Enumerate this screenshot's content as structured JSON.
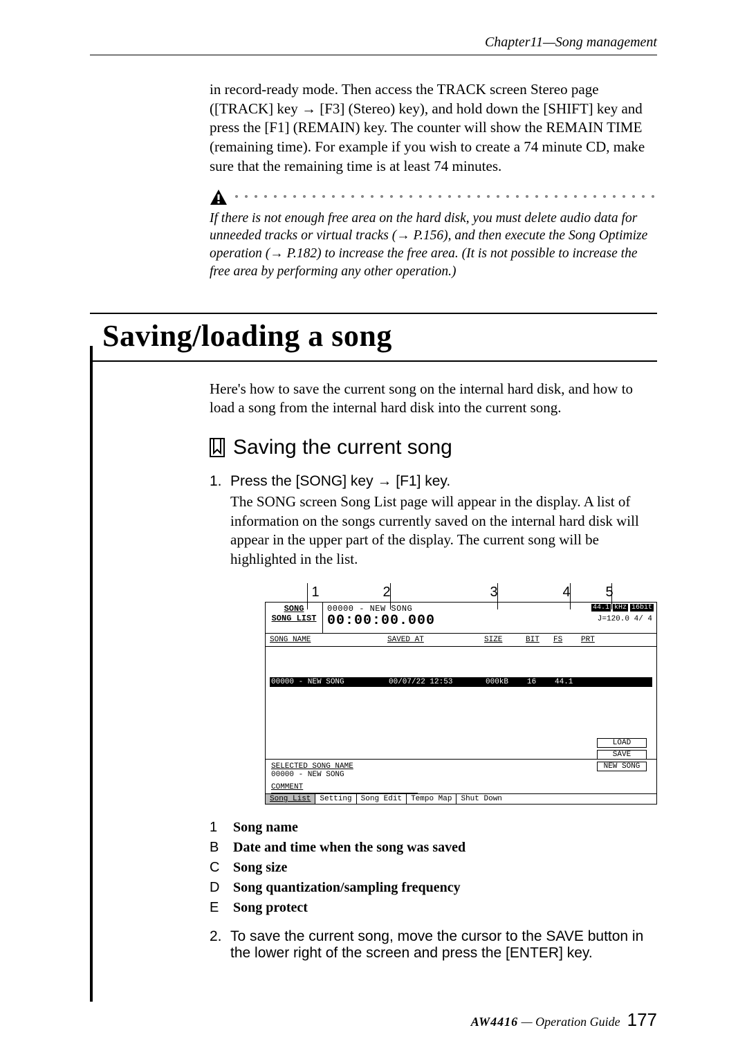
{
  "header": {
    "chapter": "Chapter11—Song management"
  },
  "intro_continued": "in record-ready mode. Then access the TRACK screen Stereo page ([TRACK] key → [F3] (Stereo) key), and hold down the [SHIFT] key and press the [F1] (REMAIN) key. The counter will show the REMAIN TIME (remaining time). For example if you wish to create a 74 minute CD, make sure that the remaining time is at least 74 minutes.",
  "warning": "If there is not enough free area on the hard disk, you must delete audio data for unneeded tracks or virtual tracks (→ P.156), and then execute the Song Optimize operation (→ P.182) to increase the free area. (It is not possible to increase the free area by performing any other operation.)",
  "h1": "Saving/loading a song",
  "intro2": "Here's how to save the current song on the internal hard disk, and how to load a song from the internal hard disk into the current song.",
  "subhead": "Saving the current song",
  "step1": {
    "num": "1.",
    "cmd": "Press the [SONG] key → [F1] key.",
    "detail": "The SONG screen Song List page will appear in the display. A list of information on the songs currently saved on the internal hard disk will appear in the upper part of the display. The current song will be highlighted in the list."
  },
  "callouts": [
    "1",
    "2",
    "3",
    "4",
    "5"
  ],
  "lcd": {
    "title1": "SONG",
    "title2": "SONG LIST",
    "status1": "00000 - NEW SONG",
    "time": "00:00:00.000",
    "chips": {
      "a": "44.1",
      "b": "kHz",
      "c": "16bit"
    },
    "below": "J=120.0   4/ 4",
    "cols": {
      "name": "SONG NAME",
      "saved": "SAVED AT",
      "size": "SIZE",
      "bit": "BIT",
      "fs": "FS",
      "prt": "PRT"
    },
    "row": {
      "name": "00000 - NEW SONG",
      "saved": "00/07/22 12:53",
      "size": "000kB",
      "bit": "16",
      "fs": "44.1"
    },
    "selected_label": "SELECTED SONG NAME",
    "selected_value": "00000 - NEW SONG",
    "comment_label": "COMMENT",
    "buttons": {
      "load": "LOAD",
      "save": "SAVE",
      "new": "NEW SONG"
    },
    "tabs": {
      "a": "Song List",
      "b": "Setting",
      "c": "Song Edit",
      "d": "Tempo Map",
      "e": "Shut Down"
    }
  },
  "legend": [
    {
      "k": "1",
      "v": "Song name"
    },
    {
      "k": "B",
      "v": "Date and time when the song was saved"
    },
    {
      "k": "C",
      "v": "Song size"
    },
    {
      "k": "D",
      "v": "Song quantization/sampling frequency"
    },
    {
      "k": "E",
      "v": "Song protect"
    }
  ],
  "step2": {
    "num": "2.",
    "cmd": "To save the current song, move the cursor to the SAVE button in the lower right of the screen and press the [ENTER] key."
  },
  "footer": {
    "brand": "AW4416",
    "rest": " — Operation Guide",
    "page": "177"
  }
}
